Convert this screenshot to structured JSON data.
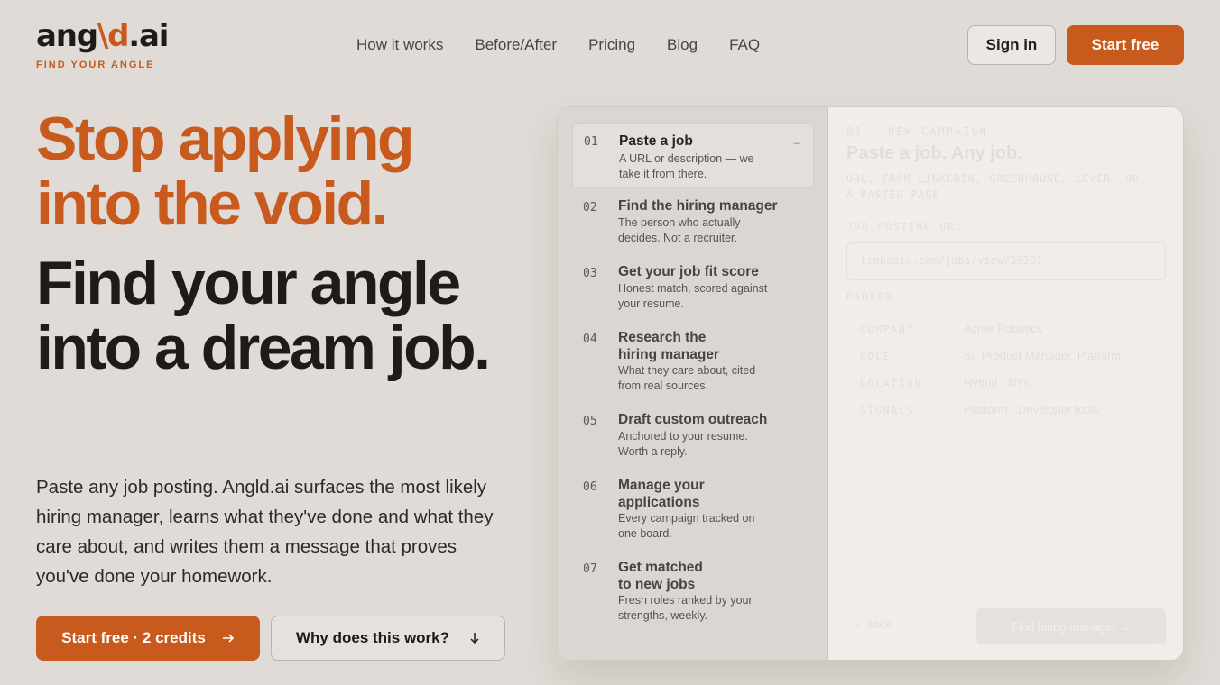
{
  "brand": {
    "name_pre": "ang",
    "name_slash": "\\d",
    "name_post": ".ai",
    "tagline": "FIND YOUR ANGLE",
    "accent": "#c85a1e"
  },
  "nav": [
    {
      "label": "How it works"
    },
    {
      "label": "Before/After"
    },
    {
      "label": "Pricing"
    },
    {
      "label": "Blog"
    },
    {
      "label": "FAQ"
    }
  ],
  "header": {
    "signin_label": "Sign in",
    "start_label": "Start free"
  },
  "hero": {
    "headline_accent": "Stop applying into the void.",
    "headline_main": "Find your angle into a dream job.",
    "lede": "Paste any job posting. Angld.ai surfaces the most likely hiring manager, learns what they've done and what they care about, and writes them a message that proves you've done your homework.",
    "cta_primary": "Start free · 2 credits",
    "cta_primary_icon": "arrow-right-icon",
    "cta_secondary": "Why does this work?",
    "cta_secondary_icon": "arrow-down-icon"
  },
  "steps": [
    {
      "num": "01",
      "title": "Paste a job",
      "desc": "A URL or description — we take it from there.",
      "arrow": "→"
    },
    {
      "num": "02",
      "title": "Find the hiring manager",
      "desc": "The person who actually decides. Not a recruiter."
    },
    {
      "num": "03",
      "title": "Get your job fit score",
      "desc": "Honest match, scored against your resume."
    },
    {
      "num": "04",
      "title": "Research the hiring manager",
      "desc": "What they care about, cited from real sources."
    },
    {
      "num": "05",
      "title": "Draft custom outreach",
      "desc": "Anchored to your resume. Worth a reply."
    },
    {
      "num": "06",
      "title": "Manage your applications",
      "desc": "Every campaign tracked on one board."
    },
    {
      "num": "07",
      "title": "Get matched to new jobs",
      "desc": "Fresh roles ranked by your strengths, weekly."
    }
  ],
  "form": {
    "kicker": "01 · NEW CAMPAIGN",
    "title": "Paste a job. Any job.",
    "subtitle": "URL, FROM LINKEDIN, GREENHOUSE, LEVER, OR A PASTED PAGE",
    "url_label": "JOB POSTING URL",
    "url_value": "linkedin.com/jobs/view/39201",
    "parsed_label": "PARSED",
    "rows": [
      {
        "k": "COMPANY",
        "v": "Acme Robotics"
      },
      {
        "k": "ROLE",
        "v": "Sr. Product Manager, Platform"
      },
      {
        "k": "LOCATION",
        "v": "Hybrid · NYC"
      },
      {
        "k": "SIGNALS",
        "v": "Platform · Developer tools"
      }
    ],
    "back_label": "← BACK",
    "submit_label": "Find hiring manager →"
  }
}
